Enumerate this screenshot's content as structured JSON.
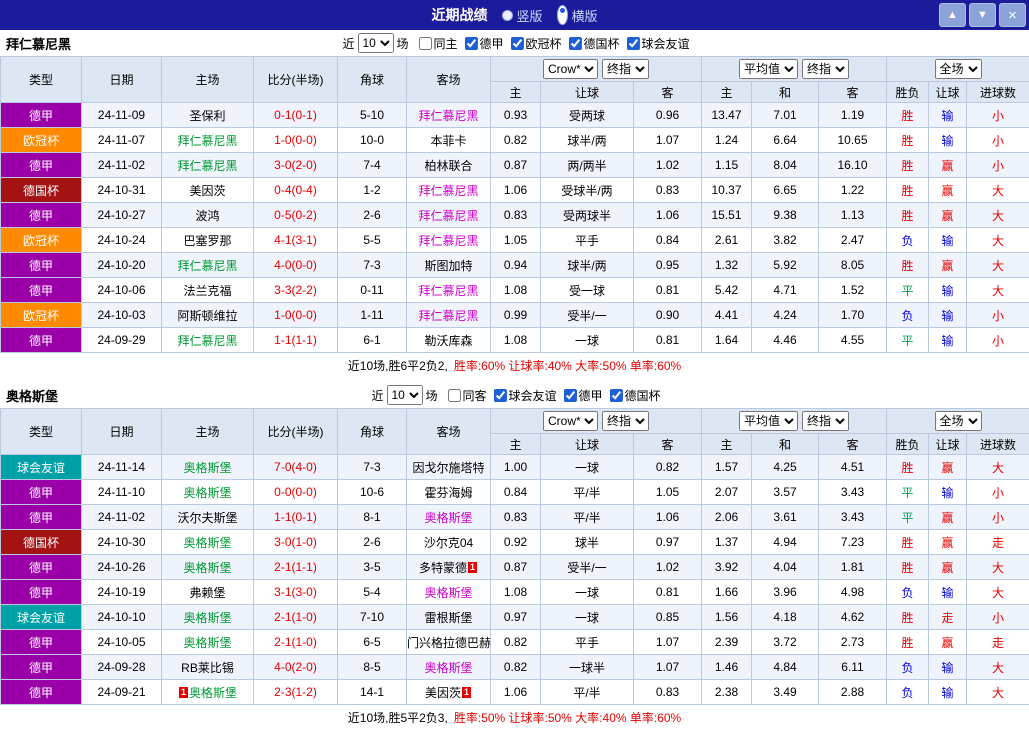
{
  "palette": {
    "titlebar_bg": "#1b1b9b",
    "header_bg": "#dde7f3",
    "row_alt_bg": "#eff3fb",
    "border": "#b9c9e0",
    "red": "#e60000",
    "blue": "#0000dd",
    "green": "#00a050",
    "home_team_text": "#009933",
    "away_team_text": "#cc00cc",
    "league_colors": {
      "德甲": "#9b00a8",
      "欧冠杯": "#ff8a00",
      "德国杯": "#a31313",
      "球会友谊": "#00a0a8"
    }
  },
  "titlebar": {
    "title": "近期战绩",
    "radios": [
      {
        "label": "竖版",
        "selected": false
      },
      {
        "label": "横版",
        "selected": true
      }
    ],
    "buttons": [
      {
        "name": "up",
        "glyph": "▲"
      },
      {
        "name": "down",
        "glyph": "▼"
      },
      {
        "name": "close",
        "glyph": "×"
      }
    ]
  },
  "table_header": {
    "static_cols": [
      "类型",
      "日期",
      "主场",
      "比分(半场)",
      "角球",
      "客场"
    ],
    "group1_selects": [
      "Crow*",
      "终指"
    ],
    "group2_selects": [
      "平均值",
      "终指"
    ],
    "group3_selects": [
      "全场"
    ],
    "group1_cols": [
      "主",
      "让球",
      "客"
    ],
    "group2_cols": [
      "主",
      "和",
      "客"
    ],
    "group3_cols": [
      "胜负",
      "让球",
      "进球数"
    ]
  },
  "sections": [
    {
      "team": "拜仁慕尼黑",
      "filters": {
        "prefix": "近",
        "count": "10",
        "suffix": "场",
        "same": {
          "label": "同主",
          "checked": false
        },
        "leagues": [
          {
            "label": "德甲",
            "checked": true
          },
          {
            "label": "欧冠杯",
            "checked": true
          },
          {
            "label": "德国杯",
            "checked": true
          },
          {
            "label": "球会友谊",
            "checked": true
          }
        ]
      },
      "rows": [
        {
          "league": "德甲",
          "date": "24-11-09",
          "home": {
            "t": "圣保利",
            "c": ""
          },
          "score": "0-1(0-1)",
          "corner": "5-10",
          "away": {
            "t": "拜仁慕尼黑",
            "c": "away"
          },
          "odds": [
            "0.93",
            "受两球",
            "0.96"
          ],
          "avg": [
            "13.47",
            "7.01",
            "1.19"
          ],
          "res": [
            [
              "胜",
              "red"
            ],
            [
              "输",
              "blue"
            ],
            [
              "小",
              "red"
            ]
          ]
        },
        {
          "league": "欧冠杯",
          "date": "24-11-07",
          "home": {
            "t": "拜仁慕尼黑",
            "c": "home"
          },
          "score": "1-0(0-0)",
          "corner": "10-0",
          "away": {
            "t": "本菲卡",
            "c": ""
          },
          "odds": [
            "0.82",
            "球半/两",
            "1.07"
          ],
          "avg": [
            "1.24",
            "6.64",
            "10.65"
          ],
          "res": [
            [
              "胜",
              "red"
            ],
            [
              "输",
              "blue"
            ],
            [
              "小",
              "red"
            ]
          ]
        },
        {
          "league": "德甲",
          "date": "24-11-02",
          "home": {
            "t": "拜仁慕尼黑",
            "c": "home"
          },
          "score": "3-0(2-0)",
          "corner": "7-4",
          "away": {
            "t": "柏林联合",
            "c": ""
          },
          "odds": [
            "0.87",
            "两/两半",
            "1.02"
          ],
          "avg": [
            "1.15",
            "8.04",
            "16.10"
          ],
          "res": [
            [
              "胜",
              "red"
            ],
            [
              "赢",
              "red"
            ],
            [
              "小",
              "red"
            ]
          ]
        },
        {
          "league": "德国杯",
          "date": "24-10-31",
          "home": {
            "t": "美因茨",
            "c": ""
          },
          "score": "0-4(0-4)",
          "corner": "1-2",
          "away": {
            "t": "拜仁慕尼黑",
            "c": "away"
          },
          "odds": [
            "1.06",
            "受球半/两",
            "0.83"
          ],
          "avg": [
            "10.37",
            "6.65",
            "1.22"
          ],
          "res": [
            [
              "胜",
              "red"
            ],
            [
              "赢",
              "red"
            ],
            [
              "大",
              "red"
            ]
          ]
        },
        {
          "league": "德甲",
          "date": "24-10-27",
          "home": {
            "t": "波鸿",
            "c": ""
          },
          "score": "0-5(0-2)",
          "corner": "2-6",
          "away": {
            "t": "拜仁慕尼黑",
            "c": "away"
          },
          "odds": [
            "0.83",
            "受两球半",
            "1.06"
          ],
          "avg": [
            "15.51",
            "9.38",
            "1.13"
          ],
          "res": [
            [
              "胜",
              "red"
            ],
            [
              "赢",
              "red"
            ],
            [
              "大",
              "red"
            ]
          ]
        },
        {
          "league": "欧冠杯",
          "date": "24-10-24",
          "home": {
            "t": "巴塞罗那",
            "c": ""
          },
          "score": "4-1(3-1)",
          "corner": "5-5",
          "away": {
            "t": "拜仁慕尼黑",
            "c": "away"
          },
          "odds": [
            "1.05",
            "平手",
            "0.84"
          ],
          "avg": [
            "2.61",
            "3.82",
            "2.47"
          ],
          "res": [
            [
              "负",
              "blue"
            ],
            [
              "输",
              "blue"
            ],
            [
              "大",
              "red"
            ]
          ]
        },
        {
          "league": "德甲",
          "date": "24-10-20",
          "home": {
            "t": "拜仁慕尼黑",
            "c": "home"
          },
          "score": "4-0(0-0)",
          "corner": "7-3",
          "away": {
            "t": "斯图加特",
            "c": ""
          },
          "odds": [
            "0.94",
            "球半/两",
            "0.95"
          ],
          "avg": [
            "1.32",
            "5.92",
            "8.05"
          ],
          "res": [
            [
              "胜",
              "red"
            ],
            [
              "赢",
              "red"
            ],
            [
              "大",
              "red"
            ]
          ]
        },
        {
          "league": "德甲",
          "date": "24-10-06",
          "home": {
            "t": "法兰克福",
            "c": ""
          },
          "score": "3-3(2-2)",
          "corner": "0-11",
          "away": {
            "t": "拜仁慕尼黑",
            "c": "away"
          },
          "odds": [
            "1.08",
            "受一球",
            "0.81"
          ],
          "avg": [
            "5.42",
            "4.71",
            "1.52"
          ],
          "res": [
            [
              "平",
              "green"
            ],
            [
              "输",
              "blue"
            ],
            [
              "大",
              "red"
            ]
          ]
        },
        {
          "league": "欧冠杯",
          "date": "24-10-03",
          "home": {
            "t": "阿斯顿维拉",
            "c": ""
          },
          "score": "1-0(0-0)",
          "corner": "1-11",
          "away": {
            "t": "拜仁慕尼黑",
            "c": "away"
          },
          "odds": [
            "0.99",
            "受半/一",
            "0.90"
          ],
          "avg": [
            "4.41",
            "4.24",
            "1.70"
          ],
          "res": [
            [
              "负",
              "blue"
            ],
            [
              "输",
              "blue"
            ],
            [
              "小",
              "red"
            ]
          ]
        },
        {
          "league": "德甲",
          "date": "24-09-29",
          "home": {
            "t": "拜仁慕尼黑",
            "c": "home"
          },
          "score": "1-1(1-1)",
          "corner": "6-1",
          "away": {
            "t": "勒沃库森",
            "c": ""
          },
          "odds": [
            "1.08",
            "一球",
            "0.81"
          ],
          "avg": [
            "1.64",
            "4.46",
            "4.55"
          ],
          "res": [
            [
              "平",
              "green"
            ],
            [
              "输",
              "blue"
            ],
            [
              "小",
              "red"
            ]
          ]
        }
      ],
      "summary": {
        "record": "近10场,胜6平2负2,",
        "rates": "胜率:60% 让球率:40% 大率:50% 单率:60%"
      }
    },
    {
      "team": "奥格斯堡",
      "filters": {
        "prefix": "近",
        "count": "10",
        "suffix": "场",
        "same": {
          "label": "同客",
          "checked": false
        },
        "leagues": [
          {
            "label": "球会友谊",
            "checked": true
          },
          {
            "label": "德甲",
            "checked": true
          },
          {
            "label": "德国杯",
            "checked": true
          }
        ]
      },
      "rows": [
        {
          "league": "球会友谊",
          "date": "24-11-14",
          "home": {
            "t": "奥格斯堡",
            "c": "home"
          },
          "score": "7-0(4-0)",
          "corner": "7-3",
          "away": {
            "t": "因戈尔施塔特",
            "c": ""
          },
          "odds": [
            "1.00",
            "一球",
            "0.82"
          ],
          "avg": [
            "1.57",
            "4.25",
            "4.51"
          ],
          "res": [
            [
              "胜",
              "red"
            ],
            [
              "赢",
              "red"
            ],
            [
              "大",
              "red"
            ]
          ]
        },
        {
          "league": "德甲",
          "date": "24-11-10",
          "home": {
            "t": "奥格斯堡",
            "c": "home"
          },
          "score": "0-0(0-0)",
          "corner": "10-6",
          "away": {
            "t": "霍芬海姆",
            "c": ""
          },
          "odds": [
            "0.84",
            "平/半",
            "1.05"
          ],
          "avg": [
            "2.07",
            "3.57",
            "3.43"
          ],
          "res": [
            [
              "平",
              "green"
            ],
            [
              "输",
              "blue"
            ],
            [
              "小",
              "red"
            ]
          ]
        },
        {
          "league": "德甲",
          "date": "24-11-02",
          "home": {
            "t": "沃尔夫斯堡",
            "c": ""
          },
          "score": "1-1(0-1)",
          "corner": "8-1",
          "away": {
            "t": "奥格斯堡",
            "c": "away"
          },
          "odds": [
            "0.83",
            "平/半",
            "1.06"
          ],
          "avg": [
            "2.06",
            "3.61",
            "3.43"
          ],
          "res": [
            [
              "平",
              "green"
            ],
            [
              "赢",
              "red"
            ],
            [
              "小",
              "red"
            ]
          ]
        },
        {
          "league": "德国杯",
          "date": "24-10-30",
          "home": {
            "t": "奥格斯堡",
            "c": "home"
          },
          "score": "3-0(1-0)",
          "corner": "2-6",
          "away": {
            "t": "沙尔克04",
            "c": ""
          },
          "odds": [
            "0.92",
            "球半",
            "0.97"
          ],
          "avg": [
            "1.37",
            "4.94",
            "7.23"
          ],
          "res": [
            [
              "胜",
              "red"
            ],
            [
              "赢",
              "red"
            ],
            [
              "走",
              "red"
            ]
          ]
        },
        {
          "league": "德甲",
          "date": "24-10-26",
          "home": {
            "t": "奥格斯堡",
            "c": "home"
          },
          "score": "2-1(1-1)",
          "corner": "3-5",
          "away": {
            "t": "多特蒙德",
            "c": "",
            "post": "1"
          },
          "odds": [
            "0.87",
            "受半/一",
            "1.02"
          ],
          "avg": [
            "3.92",
            "4.04",
            "1.81"
          ],
          "res": [
            [
              "胜",
              "red"
            ],
            [
              "赢",
              "red"
            ],
            [
              "大",
              "red"
            ]
          ]
        },
        {
          "league": "德甲",
          "date": "24-10-19",
          "home": {
            "t": "弗赖堡",
            "c": ""
          },
          "score": "3-1(3-0)",
          "corner": "5-4",
          "away": {
            "t": "奥格斯堡",
            "c": "away"
          },
          "odds": [
            "1.08",
            "一球",
            "0.81"
          ],
          "avg": [
            "1.66",
            "3.96",
            "4.98"
          ],
          "res": [
            [
              "负",
              "blue"
            ],
            [
              "输",
              "blue"
            ],
            [
              "大",
              "red"
            ]
          ]
        },
        {
          "league": "球会友谊",
          "date": "24-10-10",
          "home": {
            "t": "奥格斯堡",
            "c": "home"
          },
          "score": "2-1(1-0)",
          "corner": "7-10",
          "away": {
            "t": "雷根斯堡",
            "c": ""
          },
          "odds": [
            "0.97",
            "一球",
            "0.85"
          ],
          "avg": [
            "1.56",
            "4.18",
            "4.62"
          ],
          "res": [
            [
              "胜",
              "red"
            ],
            [
              "走",
              "red"
            ],
            [
              "小",
              "red"
            ]
          ]
        },
        {
          "league": "德甲",
          "date": "24-10-05",
          "home": {
            "t": "奥格斯堡",
            "c": "home"
          },
          "score": "2-1(1-0)",
          "corner": "6-5",
          "away": {
            "t": "门兴格拉德巴赫",
            "c": ""
          },
          "odds": [
            "0.82",
            "平手",
            "1.07"
          ],
          "avg": [
            "2.39",
            "3.72",
            "2.73"
          ],
          "res": [
            [
              "胜",
              "red"
            ],
            [
              "赢",
              "red"
            ],
            [
              "走",
              "red"
            ]
          ]
        },
        {
          "league": "德甲",
          "date": "24-09-28",
          "home": {
            "t": "RB莱比锡",
            "c": ""
          },
          "score": "4-0(2-0)",
          "corner": "8-5",
          "away": {
            "t": "奥格斯堡",
            "c": "away"
          },
          "odds": [
            "0.82",
            "一球半",
            "1.07"
          ],
          "avg": [
            "1.46",
            "4.84",
            "6.11"
          ],
          "res": [
            [
              "负",
              "blue"
            ],
            [
              "输",
              "blue"
            ],
            [
              "大",
              "red"
            ]
          ]
        },
        {
          "league": "德甲",
          "date": "24-09-21",
          "home": {
            "t": "奥格斯堡",
            "c": "home",
            "pre": "1"
          },
          "score": "2-3(1-2)",
          "corner": "14-1",
          "away": {
            "t": "美因茨",
            "c": "",
            "post": "1"
          },
          "odds": [
            "1.06",
            "平/半",
            "0.83"
          ],
          "avg": [
            "2.38",
            "3.49",
            "2.88"
          ],
          "res": [
            [
              "负",
              "blue"
            ],
            [
              "输",
              "blue"
            ],
            [
              "大",
              "red"
            ]
          ]
        }
      ],
      "summary": {
        "record": "近10场,胜5平2负3,",
        "rates": "胜率:50% 让球率:50% 大率:40% 单率:60%"
      }
    }
  ]
}
